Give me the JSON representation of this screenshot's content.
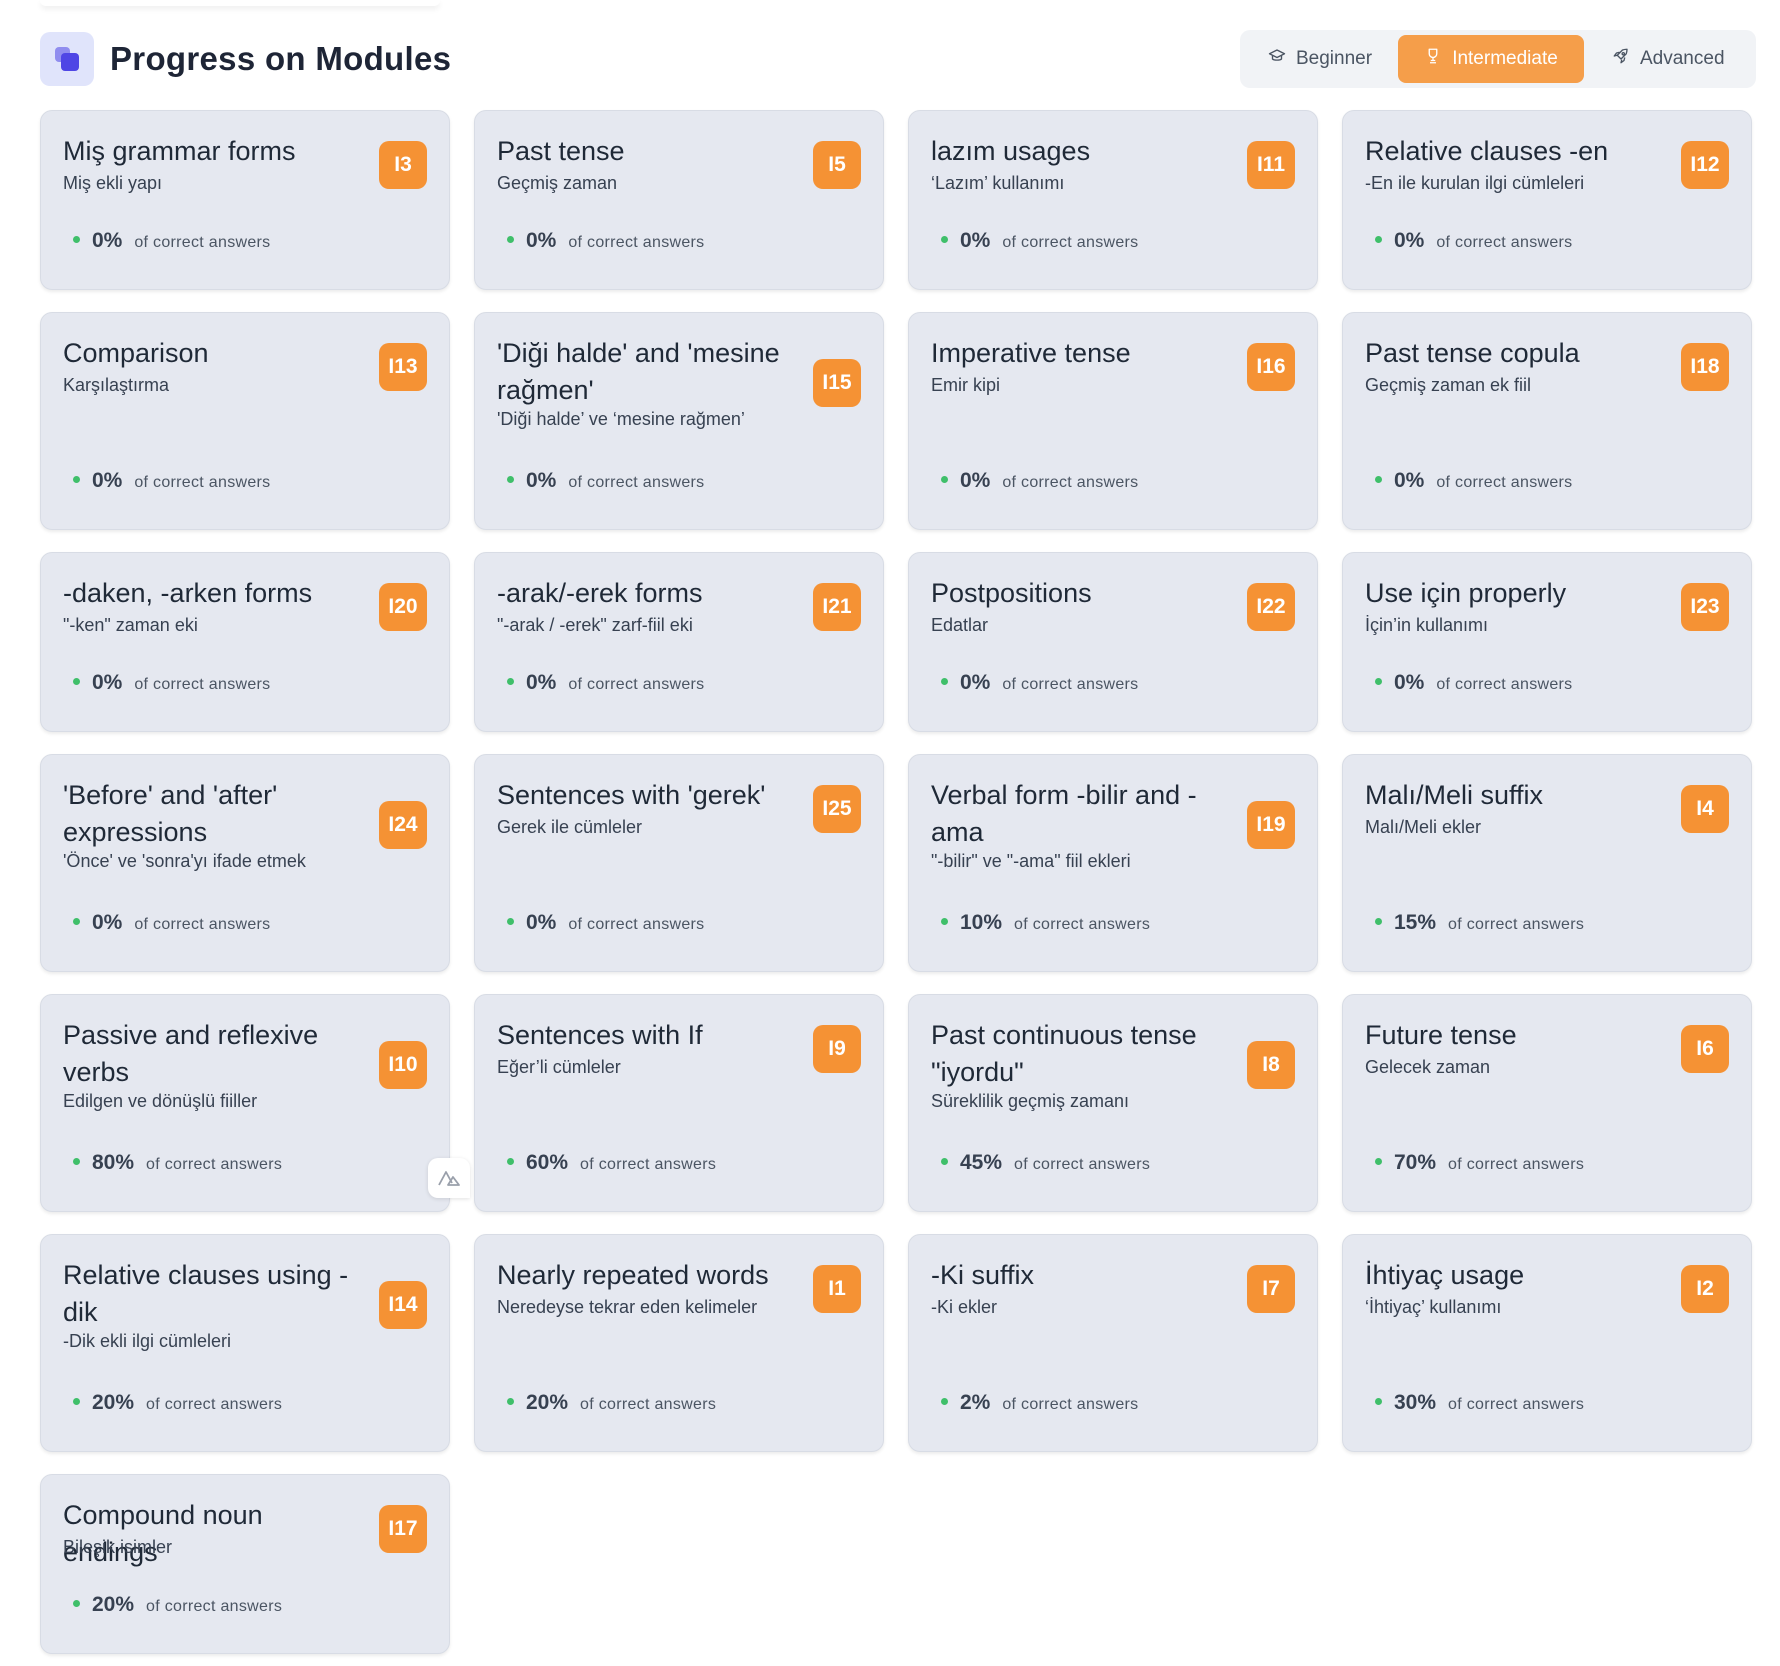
{
  "header": {
    "title": "Progress on Modules",
    "tabs": [
      {
        "label": "Beginner",
        "icon": "graduation-cap-icon",
        "active": false
      },
      {
        "label": "Intermediate",
        "icon": "trophy-icon",
        "active": true
      },
      {
        "label": "Advanced",
        "icon": "rocket-icon",
        "active": false
      }
    ]
  },
  "progress_suffix": "of correct answers",
  "colors": {
    "accent": "#f59234",
    "brand": "#4f46e5",
    "card_bg": "#e5e8f0",
    "progress_dot": "#3fbf6a"
  },
  "modules": [
    {
      "title": "Miş grammar forms",
      "subtitle": "Miş ekli yapı",
      "code": "I3",
      "percent": "0%"
    },
    {
      "title": "Past tense",
      "subtitle": "Geçmiş zaman",
      "code": "I5",
      "percent": "0%"
    },
    {
      "title": "lazım usages",
      "subtitle": "‘Lazım’ kullanımı",
      "code": "I11",
      "percent": "0%"
    },
    {
      "title": "Relative clauses -en",
      "subtitle": "-En ile kurulan ilgi cümleleri",
      "code": "I12",
      "percent": "0%"
    },
    {
      "title": "Comparison",
      "subtitle": "Karşılaştırma",
      "code": "I13",
      "percent": "0%"
    },
    {
      "title": "'Diği halde' and 'mesine rağmen'",
      "subtitle": "'Diği halde’ ve ‘mesine rağmen’",
      "code": "I15",
      "percent": "0%"
    },
    {
      "title": "Imperative tense",
      "subtitle": "Emir kipi",
      "code": "I16",
      "percent": "0%"
    },
    {
      "title": "Past tense copula",
      "subtitle": "Geçmiş zaman ek fiil",
      "code": "I18",
      "percent": "0%"
    },
    {
      "title": "-daken, -arken forms",
      "subtitle": "\"-ken\" zaman eki",
      "code": "I20",
      "percent": "0%"
    },
    {
      "title": "-arak/-erek forms",
      "subtitle": "\"-arak / -erek\" zarf-fiil eki",
      "code": "I21",
      "percent": "0%"
    },
    {
      "title": "Postpositions",
      "subtitle": "Edatlar",
      "code": "I22",
      "percent": "0%"
    },
    {
      "title": "Use için properly",
      "subtitle": "İçin’in kullanımı",
      "code": "I23",
      "percent": "0%"
    },
    {
      "title": "'Before' and 'after' expressions",
      "subtitle": "'Önce' ve 'sonra'yı ifade etmek",
      "code": "I24",
      "percent": "0%"
    },
    {
      "title": "Sentences with 'gerek'",
      "subtitle": "Gerek ile cümleler",
      "code": "I25",
      "percent": "0%"
    },
    {
      "title": "Verbal form -bilir and -ama",
      "subtitle": "\"-bilir\" ve \"-ama\" fiil ekleri",
      "code": "I19",
      "percent": "10%"
    },
    {
      "title": "Malı/Meli suffix",
      "subtitle": "Malı/Meli ekler",
      "code": "I4",
      "percent": "15%"
    },
    {
      "title": "Passive and reflexive verbs",
      "subtitle": "Edilgen ve dönüşlü fiiller",
      "code": "I10",
      "percent": "80%"
    },
    {
      "title": "Sentences with If",
      "subtitle": "Eğer’li cümleler",
      "code": "I9",
      "percent": "60%"
    },
    {
      "title": "Past continuous tense \"iyordu\"",
      "subtitle": "Süreklilik geçmiş zamanı",
      "code": "I8",
      "percent": "45%"
    },
    {
      "title": "Future tense",
      "subtitle": "Gelecek zaman",
      "code": "I6",
      "percent": "70%"
    },
    {
      "title": "Relative clauses using -dik",
      "subtitle": "-Dik ekli ilgi cümleleri",
      "code": "I14",
      "percent": "20%"
    },
    {
      "title": "Nearly repeated words",
      "subtitle": "Neredeyse tekrar eden kelimeler",
      "code": "I1",
      "percent": "20%"
    },
    {
      "title": "-Ki suffix",
      "subtitle": "-Ki ekler",
      "code": "I7",
      "percent": "2%"
    },
    {
      "title": "İhtiyaç usage",
      "subtitle": "‘İhtiyaç’ kullanımı",
      "code": "I2",
      "percent": "30%"
    },
    {
      "title": "Compound noun endings",
      "subtitle": "Bileşik isimler",
      "code": "I17",
      "percent": "20%"
    }
  ]
}
